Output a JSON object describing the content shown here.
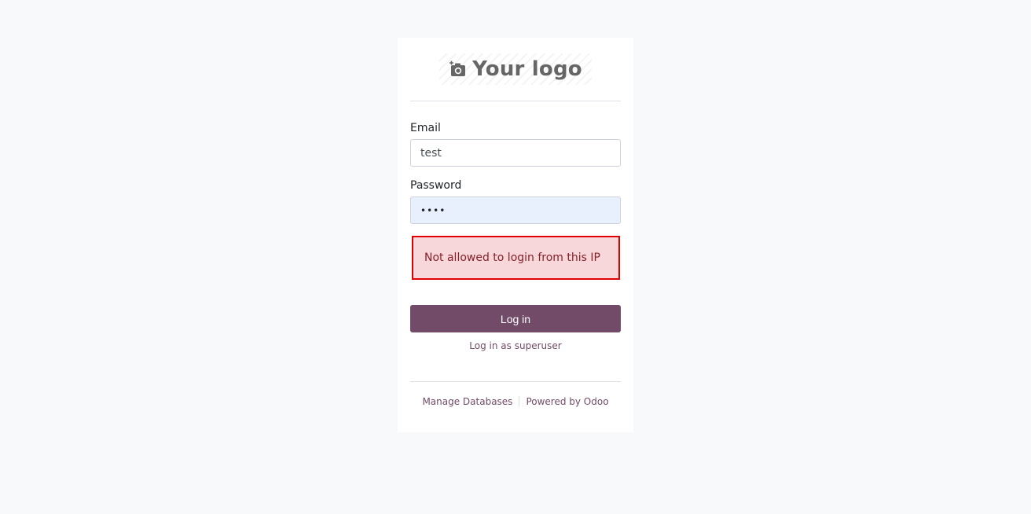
{
  "logo": {
    "text": "Your logo",
    "icon": "camera-add-icon"
  },
  "form": {
    "email_label": "Email",
    "email_value": "test",
    "password_label": "Password",
    "password_value": "••••",
    "error_message": "Not allowed to login from this IP",
    "login_button": "Log in",
    "superuser_link": "Log in as superuser"
  },
  "footer": {
    "manage_databases": "Manage Databases",
    "powered_by": "Powered by Odoo"
  },
  "colors": {
    "brand": "#714b67",
    "error_border": "#e00000",
    "error_bg": "#f8d7da",
    "autofill_bg": "#e8f0fe"
  }
}
